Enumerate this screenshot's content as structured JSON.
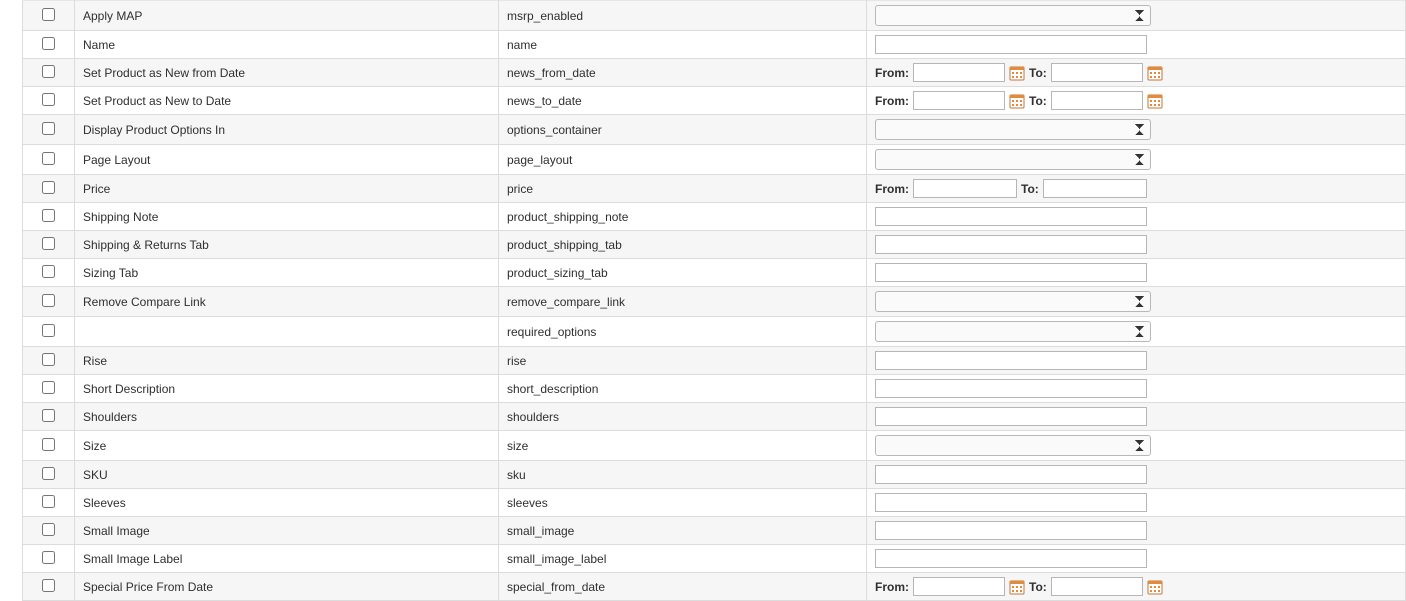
{
  "labels": {
    "from": "From:",
    "to": "To:"
  },
  "rows": [
    {
      "label": "Apply MAP",
      "code": "msrp_enabled",
      "filter": "select"
    },
    {
      "label": "Name",
      "code": "name",
      "filter": "text"
    },
    {
      "label": "Set Product as New from Date",
      "code": "news_from_date",
      "filter": "daterange"
    },
    {
      "label": "Set Product as New to Date",
      "code": "news_to_date",
      "filter": "daterange"
    },
    {
      "label": "Display Product Options In",
      "code": "options_container",
      "filter": "select"
    },
    {
      "label": "Page Layout",
      "code": "page_layout",
      "filter": "select"
    },
    {
      "label": "Price",
      "code": "price",
      "filter": "numrange"
    },
    {
      "label": "Shipping Note",
      "code": "product_shipping_note",
      "filter": "text"
    },
    {
      "label": "Shipping & Returns Tab",
      "code": "product_shipping_tab",
      "filter": "text"
    },
    {
      "label": "Sizing Tab",
      "code": "product_sizing_tab",
      "filter": "text"
    },
    {
      "label": "Remove Compare Link",
      "code": "remove_compare_link",
      "filter": "select"
    },
    {
      "label": "",
      "code": "required_options",
      "filter": "select"
    },
    {
      "label": "Rise",
      "code": "rise",
      "filter": "text"
    },
    {
      "label": "Short Description",
      "code": "short_description",
      "filter": "text"
    },
    {
      "label": "Shoulders",
      "code": "shoulders",
      "filter": "text"
    },
    {
      "label": "Size",
      "code": "size",
      "filter": "select"
    },
    {
      "label": "SKU",
      "code": "sku",
      "filter": "text"
    },
    {
      "label": "Sleeves",
      "code": "sleeves",
      "filter": "text"
    },
    {
      "label": "Small Image",
      "code": "small_image",
      "filter": "text"
    },
    {
      "label": "Small Image Label",
      "code": "small_image_label",
      "filter": "text"
    },
    {
      "label": "Special Price From Date",
      "code": "special_from_date",
      "filter": "daterange"
    }
  ]
}
